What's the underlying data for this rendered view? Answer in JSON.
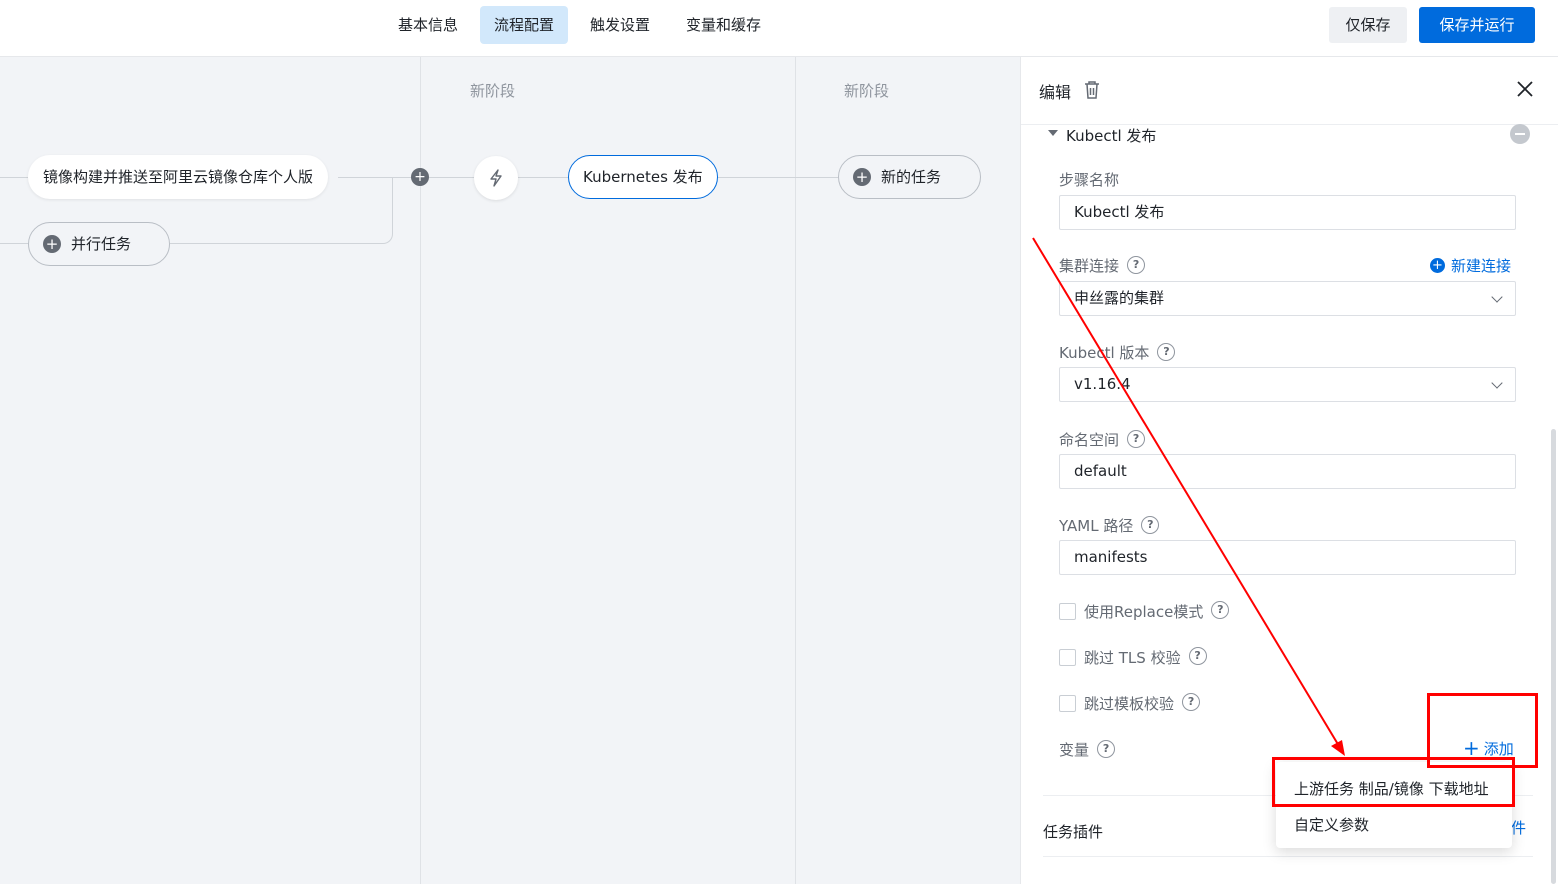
{
  "topbar": {
    "tabs": [
      {
        "label": "基本信息",
        "active": false
      },
      {
        "label": "流程配置",
        "active": true
      },
      {
        "label": "触发设置",
        "active": false
      },
      {
        "label": "变量和缓存",
        "active": false
      }
    ],
    "save_only_label": "仅保存",
    "save_run_label": "保存并运行"
  },
  "canvas": {
    "stage_titles": [
      "新阶段",
      "新阶段"
    ],
    "nodes": {
      "build_task": "镜像构建并推送至阿里云镜像仓库个人版",
      "parallel_task": "并行任务",
      "k8s_deploy": "Kubernetes 发布",
      "new_task": "新的任务"
    }
  },
  "panel": {
    "title": "编辑",
    "section_title": "Kubectl 发布",
    "fields": {
      "step_name": {
        "label": "步骤名称",
        "value": "Kubectl 发布"
      },
      "cluster": {
        "label": "集群连接",
        "value": "申丝露的集群",
        "new_link": "新建连接"
      },
      "kubectl_version": {
        "label": "Kubectl 版本",
        "value": "v1.16.4"
      },
      "namespace": {
        "label": "命名空间",
        "value": "default"
      },
      "yaml_path": {
        "label": "YAML 路径",
        "value": "manifests"
      }
    },
    "checkboxes": [
      {
        "label": "使用Replace模式",
        "checked": false
      },
      {
        "label": "跳过 TLS 校验",
        "checked": false
      },
      {
        "label": "跳过模板校验",
        "checked": false
      }
    ],
    "variables": {
      "label": "变量",
      "add_label": "添加"
    },
    "plugins": {
      "label": "任务插件",
      "link_tail": "件"
    }
  },
  "menu": {
    "items": [
      "上游任务 制品/镜像 下载地址",
      "自定义参数"
    ]
  },
  "colors": {
    "primary": "#006bdd",
    "annotation": "#ff0000",
    "active_tab_bg": "#d2e8fb"
  }
}
